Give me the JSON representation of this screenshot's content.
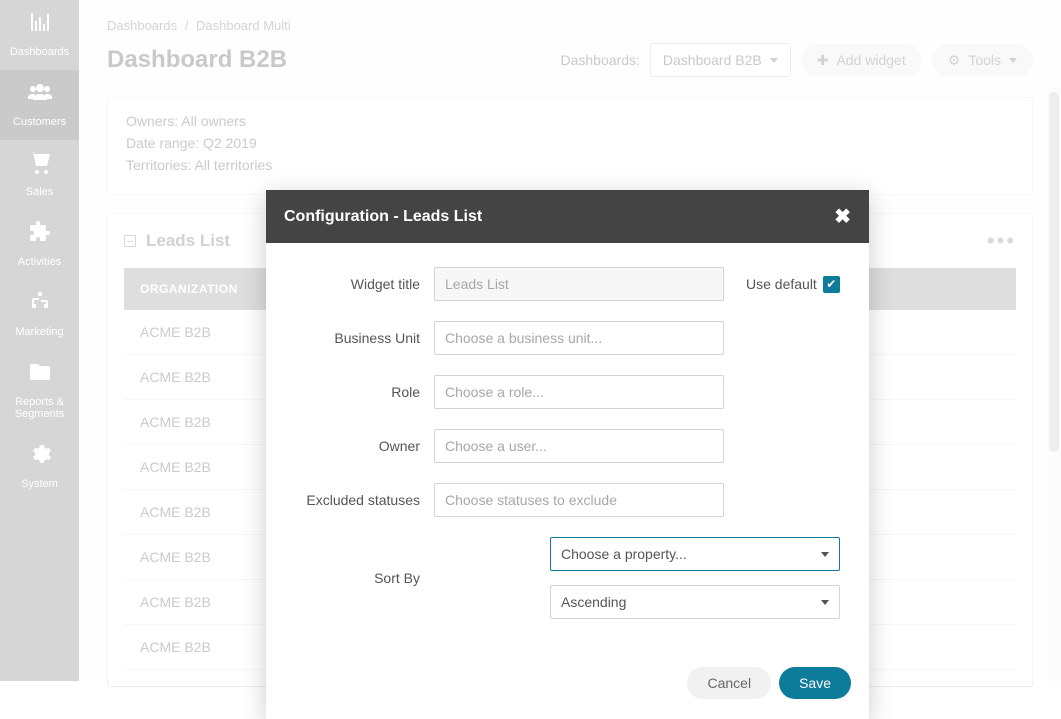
{
  "sidebar": {
    "items": [
      {
        "label": "Dashboards",
        "icon": "bar-chart"
      },
      {
        "label": "Customers",
        "icon": "users"
      },
      {
        "label": "Sales",
        "icon": "cart"
      },
      {
        "label": "Activities",
        "icon": "puzzle"
      },
      {
        "label": "Marketing",
        "icon": "sitemap"
      },
      {
        "label": "Reports & Segments",
        "icon": "folder"
      },
      {
        "label": "System",
        "icon": "gear"
      }
    ],
    "active_index": 1
  },
  "breadcrumb": {
    "parent": "Dashboards",
    "current": "Dashboard Multi"
  },
  "page_title": "Dashboard B2B",
  "header_controls": {
    "dropdown_label": "Dashboards:",
    "dropdown_value": "Dashboard B2B",
    "add_widget_label": "Add widget",
    "tools_label": "Tools"
  },
  "info_card": {
    "owners": "Owners: All owners",
    "date_range": "Date range: Q2 2019",
    "territories": "Territories: All territories"
  },
  "leads": {
    "title": "Leads List",
    "column_header": "ORGANIZATION",
    "rows": [
      "ACME B2B",
      "ACME B2B",
      "ACME B2B",
      "ACME B2B",
      "ACME B2B",
      "ACME B2B",
      "ACME B2B",
      "ACME B2B"
    ]
  },
  "modal": {
    "title": "Configuration - Leads List",
    "fields": {
      "widget_title": {
        "label": "Widget title",
        "value": "Leads List"
      },
      "use_default_label": "Use default",
      "business_unit": {
        "label": "Business Unit",
        "placeholder": "Choose a business unit..."
      },
      "role": {
        "label": "Role",
        "placeholder": "Choose a role..."
      },
      "owner": {
        "label": "Owner",
        "placeholder": "Choose a user..."
      },
      "excluded": {
        "label": "Excluded statuses",
        "placeholder": "Choose statuses to exclude"
      },
      "sort_by_label": "Sort By",
      "sort_property": "Choose a property...",
      "sort_direction": "Ascending"
    },
    "buttons": {
      "cancel": "Cancel",
      "save": "Save"
    }
  }
}
